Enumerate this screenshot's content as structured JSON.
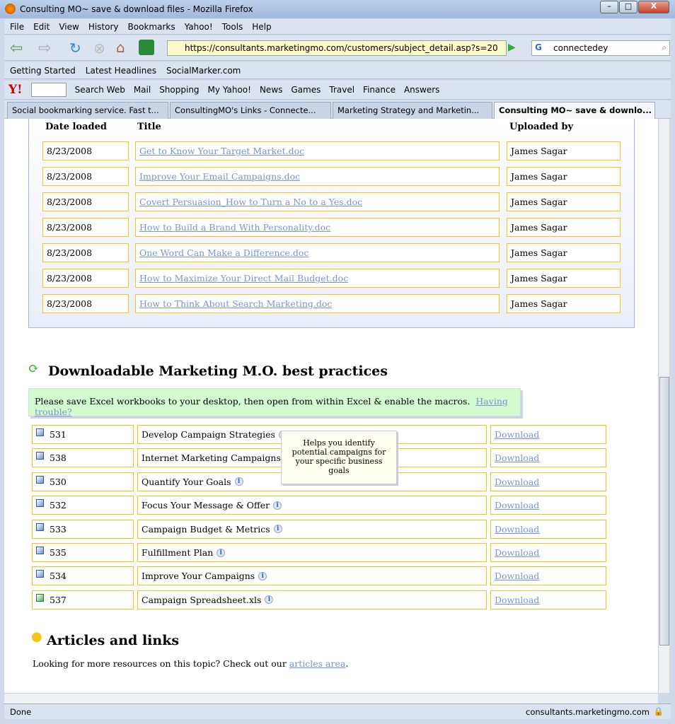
{
  "window": {
    "title": "Consulting MO~ save & download files - Mozilla Firefox"
  },
  "menu": [
    "File",
    "Edit",
    "View",
    "History",
    "Bookmarks",
    "Yahoo!",
    "Tools",
    "Help"
  ],
  "nav": {
    "url": "https://consultants.marketingmo.com/customers/subject_detail.asp?s=20",
    "search_value": "connectedey"
  },
  "bookmarks": [
    "Getting Started",
    "Latest Headlines",
    "SocialMarker.com"
  ],
  "yahoo_toolbar": [
    "Search Web",
    "Mail",
    "Shopping",
    "My Yahoo!",
    "News",
    "Games",
    "Travel",
    "Finance",
    "Answers"
  ],
  "tabs": [
    "Social bookmarking service. Fast t...",
    "ConsultingMO's Links - Connecte...",
    "Marketing Strategy and Marketin...",
    "Consulting MO~ save & downlo..."
  ],
  "files": {
    "headers": {
      "date": "Date loaded",
      "title": "Title",
      "uploaded": "Uploaded by"
    },
    "rows": [
      {
        "date": "8/23/2008",
        "title": "Get to Know Your Target Market.doc",
        "uploaded": "James Sagar"
      },
      {
        "date": "8/23/2008",
        "title": "Improve Your Email Campaigns.doc",
        "uploaded": "James Sagar"
      },
      {
        "date": "8/23/2008",
        "title": "Covert Persuasion_How to Turn a No to a Yes.doc",
        "uploaded": "James Sagar"
      },
      {
        "date": "8/23/2008",
        "title": "How to Build a Brand With Personality.doc",
        "uploaded": "James Sagar"
      },
      {
        "date": "8/23/2008",
        "title": "One Word Can Make a Difference.doc",
        "uploaded": "James Sagar"
      },
      {
        "date": "8/23/2008",
        "title": "How to Maximize Your Direct Mail Budget.doc",
        "uploaded": "James Sagar"
      },
      {
        "date": "8/23/2008",
        "title": "How to Think About Search Marketing.doc",
        "uploaded": "James Sagar"
      }
    ]
  },
  "best_practices": {
    "heading": "Downloadable Marketing M.O. best practices",
    "note": "Please save Excel workbooks to your desktop, then open from within Excel & enable the macros.",
    "note_link": "Having trouble?",
    "download_label": "Download",
    "rows": [
      {
        "id": "531",
        "name": "Develop Campaign Strategies",
        "type": "word"
      },
      {
        "id": "538",
        "name": "Internet Marketing Campaigns",
        "type": "word"
      },
      {
        "id": "530",
        "name": "Quantify Your Goals",
        "type": "word"
      },
      {
        "id": "532",
        "name": "Focus Your Message & Offer",
        "type": "word"
      },
      {
        "id": "533",
        "name": "Campaign Budget & Metrics",
        "type": "word"
      },
      {
        "id": "535",
        "name": "Fulfillment Plan",
        "type": "word"
      },
      {
        "id": "534",
        "name": "Improve Your Campaigns",
        "type": "word"
      },
      {
        "id": "537",
        "name": "Campaign Spreadsheet.xls",
        "type": "excel"
      }
    ],
    "tooltip": "Helps you identify potential campaigns for your specific business goals"
  },
  "articles": {
    "heading": "Articles and links",
    "text": "Looking for more resources on this topic? Check out our ",
    "link": "articles area",
    "suffix": "."
  },
  "status": {
    "left": "Done",
    "right": "consultants.marketingmo.com"
  }
}
